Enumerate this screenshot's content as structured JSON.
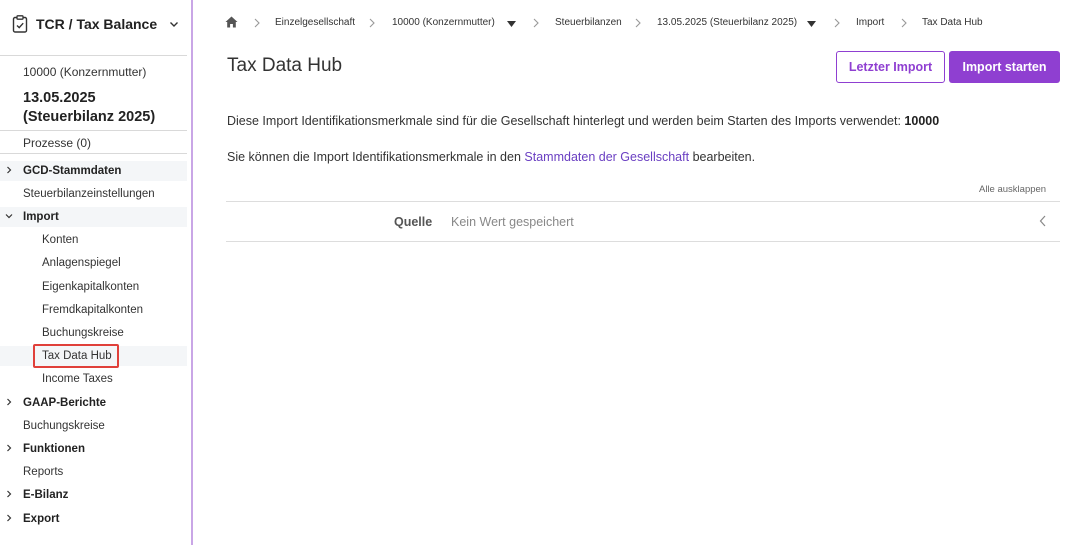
{
  "app": {
    "title": "TCR / Tax Balance"
  },
  "context": {
    "company": "10000 (Konzernmutter)",
    "date_line1": "13.05.2025",
    "date_line2": "(Steuerbilanz 2025)",
    "processes": "Prozesse (0)"
  },
  "nav": {
    "gcd": "GCD-Stammdaten",
    "steuerbilanzeinstellungen": "Steuerbilanzeinstellungen",
    "import": "Import",
    "konten": "Konten",
    "anlagenspiegel": "Anlagenspiegel",
    "eigenkapitalkonten": "Eigenkapitalkonten",
    "fremdkapitalkonten": "Fremdkapitalkonten",
    "buchungskreise_sub": "Buchungskreise",
    "tax_data_hub": "Tax Data Hub",
    "income_taxes": "Income Taxes",
    "gaap": "GAAP-Berichte",
    "buchungskreise": "Buchungskreise",
    "funktionen": "Funktionen",
    "reports": "Reports",
    "ebilanz": "E-Bilanz",
    "export": "Export"
  },
  "breadcrumb": {
    "c1": "Einzelgesellschaft",
    "c2": "10000 (Konzernmutter)",
    "c3": "Steuerbilanzen",
    "c4": "13.05.2025 (Steuerbilanz 2025)",
    "c5": "Import",
    "c6": "Tax Data Hub"
  },
  "page": {
    "title": "Tax Data Hub",
    "last_import": "Letzter Import",
    "start_import": "Import starten",
    "info1": "Diese Import Identifikationsmerkmale sind für die Gesellschaft hinterlegt und werden beim Starten des Imports verwendet:",
    "info1_value": "10000",
    "info2_pre": "Sie können die Import Identifikationsmerkmale in den",
    "info2_link": "Stammdaten der Gesellschaft",
    "info2_post": "bearbeiten.",
    "expand_all": "Alle ausklappen",
    "source_label": "Quelle",
    "source_value": "Kein Wert gespeichert"
  },
  "colors": {
    "accent": "#8f3fd1",
    "link": "#6a3fc2",
    "highlight": "#e0403a"
  }
}
